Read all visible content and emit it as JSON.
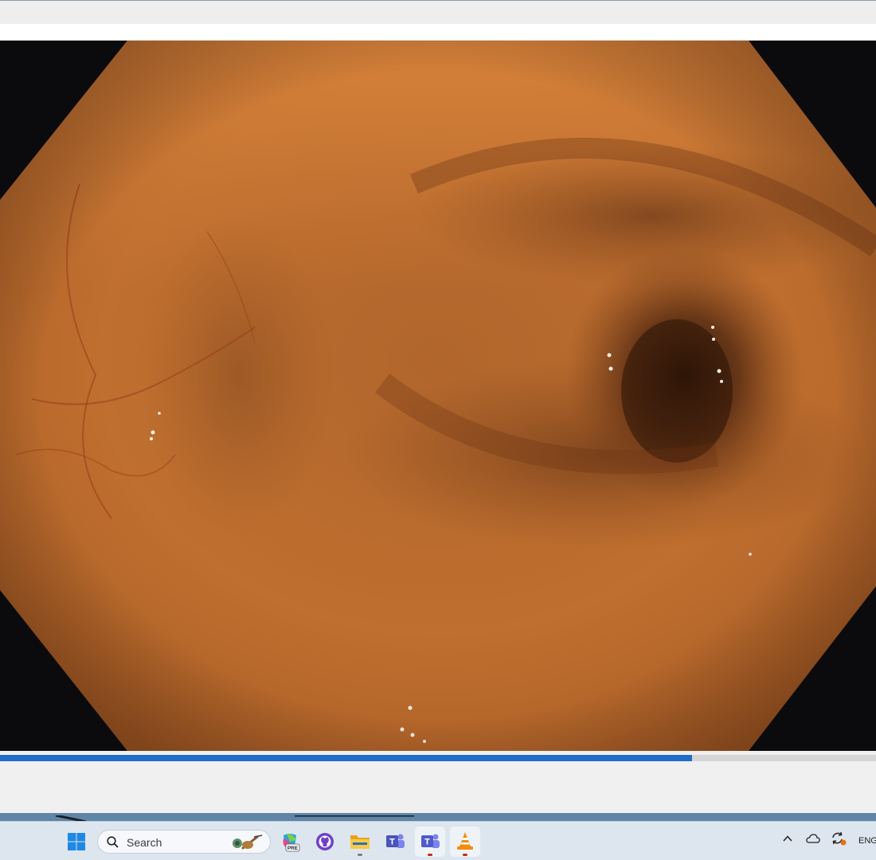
{
  "window": {
    "playback_progress": 0.79
  },
  "taskbar": {
    "search": {
      "label": "Search"
    },
    "apps": [
      {
        "name": "copilot-pre",
        "badge": "PRE"
      },
      {
        "name": "github-desktop"
      },
      {
        "name": "file-explorer"
      },
      {
        "name": "teams-classic",
        "letter": "T"
      },
      {
        "name": "teams-new",
        "letter": "T"
      },
      {
        "name": "vlc-media-player"
      }
    ],
    "tray": {
      "language": "ENG"
    }
  },
  "colors": {
    "seek_fill": "#1f6fc9",
    "taskbar_bg": "#dde6ef",
    "video_bg": "#0b0b0d"
  }
}
